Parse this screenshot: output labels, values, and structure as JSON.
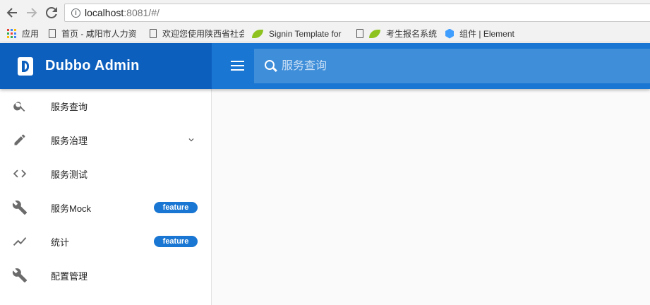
{
  "browser": {
    "url_host": "localhost",
    "url_rest": ":8081/#/",
    "bookmarks": [
      {
        "label": "应用",
        "icon": "apps-grid-icon"
      },
      {
        "label": "首页 - 咸阳市人力资",
        "icon": "document-icon"
      },
      {
        "label": "欢迎您使用陕西省社会",
        "icon": "document-icon"
      },
      {
        "label": "Signin Template for",
        "icon": "leaf-icon"
      },
      {
        "label": "考生报名系统",
        "icon": "document-icon"
      },
      {
        "label": "组件 | Element",
        "icon": "element-cube-icon"
      }
    ]
  },
  "header": {
    "title": "Dubbo Admin",
    "search_placeholder": "服务查询"
  },
  "sidebar": {
    "items": [
      {
        "label": "服务查询",
        "icon": "search-icon"
      },
      {
        "label": "服务治理",
        "icon": "pencil-icon",
        "expandable": true
      },
      {
        "label": "服务测试",
        "icon": "code-icon"
      },
      {
        "label": "服务Mock",
        "icon": "wrench-icon",
        "badge": "feature"
      },
      {
        "label": "统计",
        "icon": "trending-icon",
        "badge": "feature"
      },
      {
        "label": "配置管理",
        "icon": "wrench-icon"
      }
    ]
  },
  "colors": {
    "header": "#1976d2",
    "brand": "#0d5fbe",
    "search_field": "#3f8ed9",
    "badge": "#1976d2"
  }
}
